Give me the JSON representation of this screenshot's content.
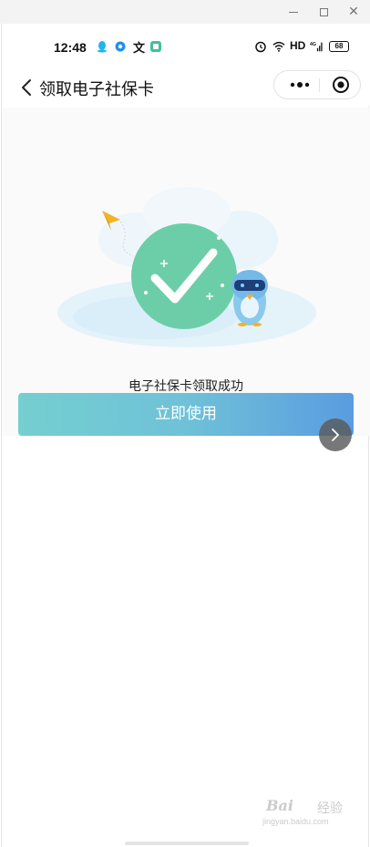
{
  "window": {
    "minimize_icon": "minimize-icon",
    "maximize_icon": "maximize-icon",
    "close_icon": "close-icon"
  },
  "status_bar": {
    "time": "12:48",
    "misc_char": "文",
    "hd_label": "HD",
    "signal_label": "4G",
    "battery": "68"
  },
  "nav": {
    "title": "领取电子社保卡"
  },
  "main": {
    "success_text": "电子社保卡领取成功",
    "use_button_label": "立即使用"
  },
  "watermark": {
    "brand": "Bai",
    "cn": "经验",
    "url": "jingyan.baidu.com"
  },
  "colors": {
    "button_gradient_start": "#74cfd0",
    "button_gradient_end": "#5a9ce0",
    "check_circle": "#6ccea8",
    "content_bg": "#fafafa"
  }
}
